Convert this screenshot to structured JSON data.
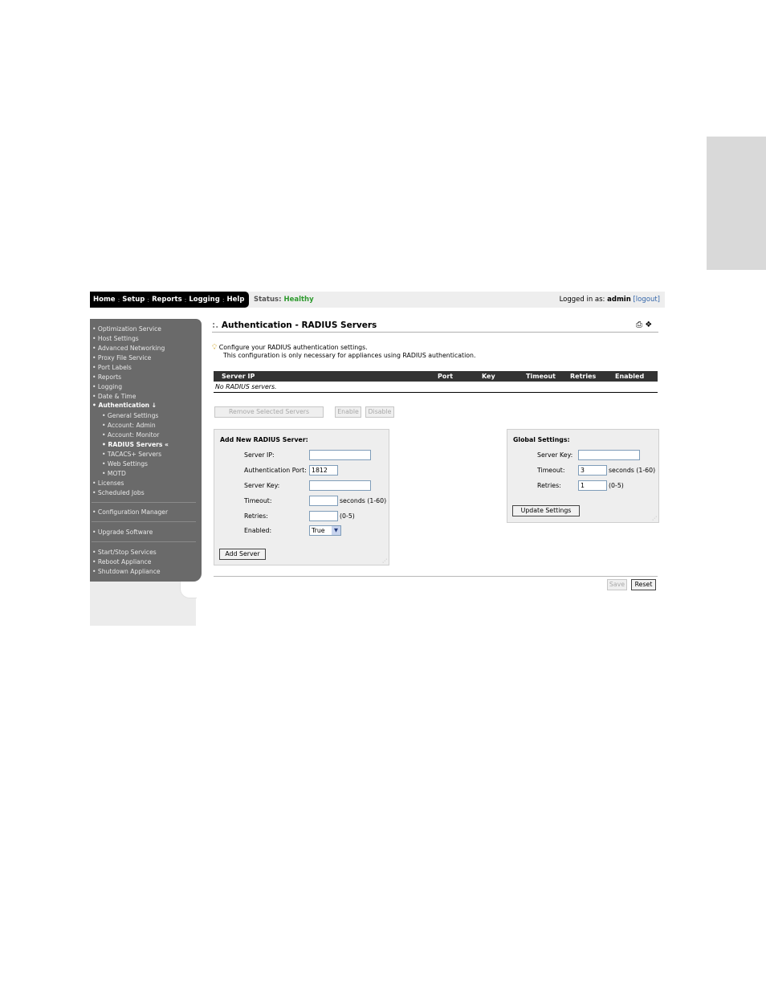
{
  "topnav": {
    "items": [
      "Home",
      "Setup",
      "Reports",
      "Logging",
      "Help"
    ],
    "status_label": "Status:",
    "status_value": "Healthy",
    "login_prefix": "Logged in as:",
    "login_user": "admin",
    "logout": "[logout]"
  },
  "sidebar": {
    "items": [
      "• Optimization Service",
      "• Host Settings",
      "• Advanced Networking",
      "• Proxy File Service",
      "• Port Labels",
      "• Reports",
      "• Logging",
      "• Date & Time",
      "• Authentication ↓"
    ],
    "subitems": [
      "• General Settings",
      "• Account: Admin",
      "• Account: Monitor",
      "• RADIUS Servers «",
      "• TACACS+ Servers",
      "• Web Settings",
      "• MOTD"
    ],
    "items2": [
      "• Licenses",
      "• Scheduled Jobs"
    ],
    "config_manager": "• Configuration Manager",
    "upgrade": "• Upgrade Software",
    "items3": [
      "• Start/Stop Services",
      "• Reboot Appliance",
      "• Shutdown Appliance"
    ]
  },
  "main": {
    "title_prefix": ":.",
    "title": "Authentication - RADIUS Servers",
    "hint_line1": "Configure your RADIUS authentication settings.",
    "hint_line2": "This configuration is only necessary for appliances using RADIUS authentication.",
    "table": {
      "columns": [
        "Server IP",
        "Port",
        "Key",
        "Timeout",
        "Retries",
        "Enabled"
      ],
      "empty": "No RADIUS servers."
    },
    "buttons": {
      "remove": "Remove Selected Servers",
      "enable": "Enable",
      "disable": "Disable",
      "save": "Save",
      "reset": "Reset"
    }
  },
  "add_server": {
    "heading": "Add New RADIUS Server:",
    "server_ip_label": "Server IP:",
    "server_ip_value": "",
    "auth_port_label": "Authentication Port:",
    "auth_port_value": "1812",
    "server_key_label": "Server Key:",
    "server_key_value": "",
    "timeout_label": "Timeout:",
    "timeout_value": "",
    "timeout_hint": "seconds (1-60)",
    "retries_label": "Retries:",
    "retries_value": "",
    "retries_hint": "(0-5)",
    "enabled_label": "Enabled:",
    "enabled_value": "True",
    "button": "Add Server"
  },
  "global_settings": {
    "heading": "Global Settings:",
    "server_key_label": "Server Key:",
    "server_key_value": "",
    "timeout_label": "Timeout:",
    "timeout_value": "3",
    "timeout_hint": "seconds (1-60)",
    "retries_label": "Retries:",
    "retries_value": "1",
    "retries_hint": "(0-5)",
    "button": "Update Settings"
  },
  "colors": {
    "sidebar": "#6a6a6a",
    "status_ok": "#2e9a2e",
    "table_header": "#333333"
  }
}
